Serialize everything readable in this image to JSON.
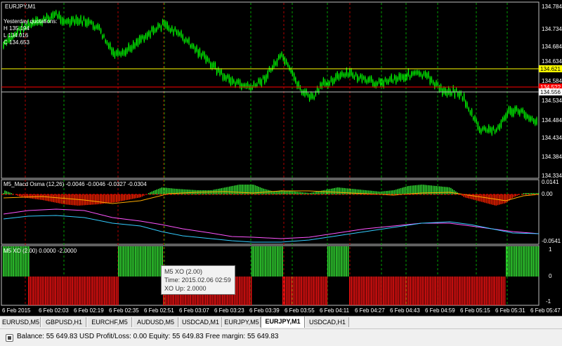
{
  "main_chart": {
    "title": "EURJPY,M1",
    "yesterday_label": "Yesterday quotations:",
    "high": "H 135.194",
    "low": "L 134.016",
    "close": "C 134.653",
    "price_labels": [
      "134.784",
      "134.734",
      "134.684",
      "134.634",
      "134.584",
      "134.534",
      "134.484",
      "134.434",
      "134.384",
      "134.334"
    ],
    "level_tags": [
      {
        "text": "134.621",
        "bg": "#ffff00",
        "fg": "#000000"
      },
      {
        "text": "134.5??",
        "bg": "#ff0000",
        "fg": "#ffffff"
      },
      {
        "text": "134.556",
        "bg": "#ffffff",
        "fg": "#000000"
      }
    ],
    "colors": {
      "candles": "#00ff00",
      "yellow_line": "#ffff00",
      "red_line": "#ff0000",
      "gray_line": "#c0c0c0",
      "red_vline": "#b00000",
      "green_vline": "#00a000"
    }
  },
  "macd_panel": {
    "label": "M5_Macd Osma (12,26) -0.0046 -0.0046 -0.0327 -0.0304",
    "scale": [
      "0.0141",
      "0.00",
      "-0.0541"
    ]
  },
  "xo_panel": {
    "label": "M5 XO (2.00) 0.0000 -2.0000",
    "scale": [
      "1",
      "0",
      "-1"
    ]
  },
  "time_labels": [
    "6 Feb 2015",
    "6 Feb 02:03",
    "6 Feb 02:19",
    "6 Feb 02:35",
    "6 Feb 02:51",
    "6 Feb 03:07",
    "6 Feb 03:23",
    "6 Feb 03:39",
    "6 Feb 03:55",
    "6 Feb 04:11",
    "6 Feb 04:27",
    "6 Feb 04:43",
    "6 Feb 04:59",
    "6 Feb 05:15",
    "6 Feb 05:31",
    "6 Feb 05:47"
  ],
  "tooltip": {
    "title": "M5 XO (2.00)",
    "time": "Time: 2015.02.06 02:59",
    "value": "XO Up: 2.0000"
  },
  "tabs": [
    {
      "label": "EURUSD,M5",
      "active": false
    },
    {
      "label": "GBPUSD,H1",
      "active": false
    },
    {
      "label": "EURCHF,M5",
      "active": false
    },
    {
      "label": "AUDUSD,M5",
      "active": false
    },
    {
      "label": "USDCAD,M1",
      "active": false
    },
    {
      "label": "EURJPY,M5",
      "active": false
    },
    {
      "label": "EURJPY,M1",
      "active": true
    },
    {
      "label": "USDCAD,H1",
      "active": false
    }
  ],
  "status": {
    "text": "Balance: 55 649.83 USD   Profit/Loss: 0.00   Equity: 55 649.83   Free margin: 55 649.83"
  }
}
